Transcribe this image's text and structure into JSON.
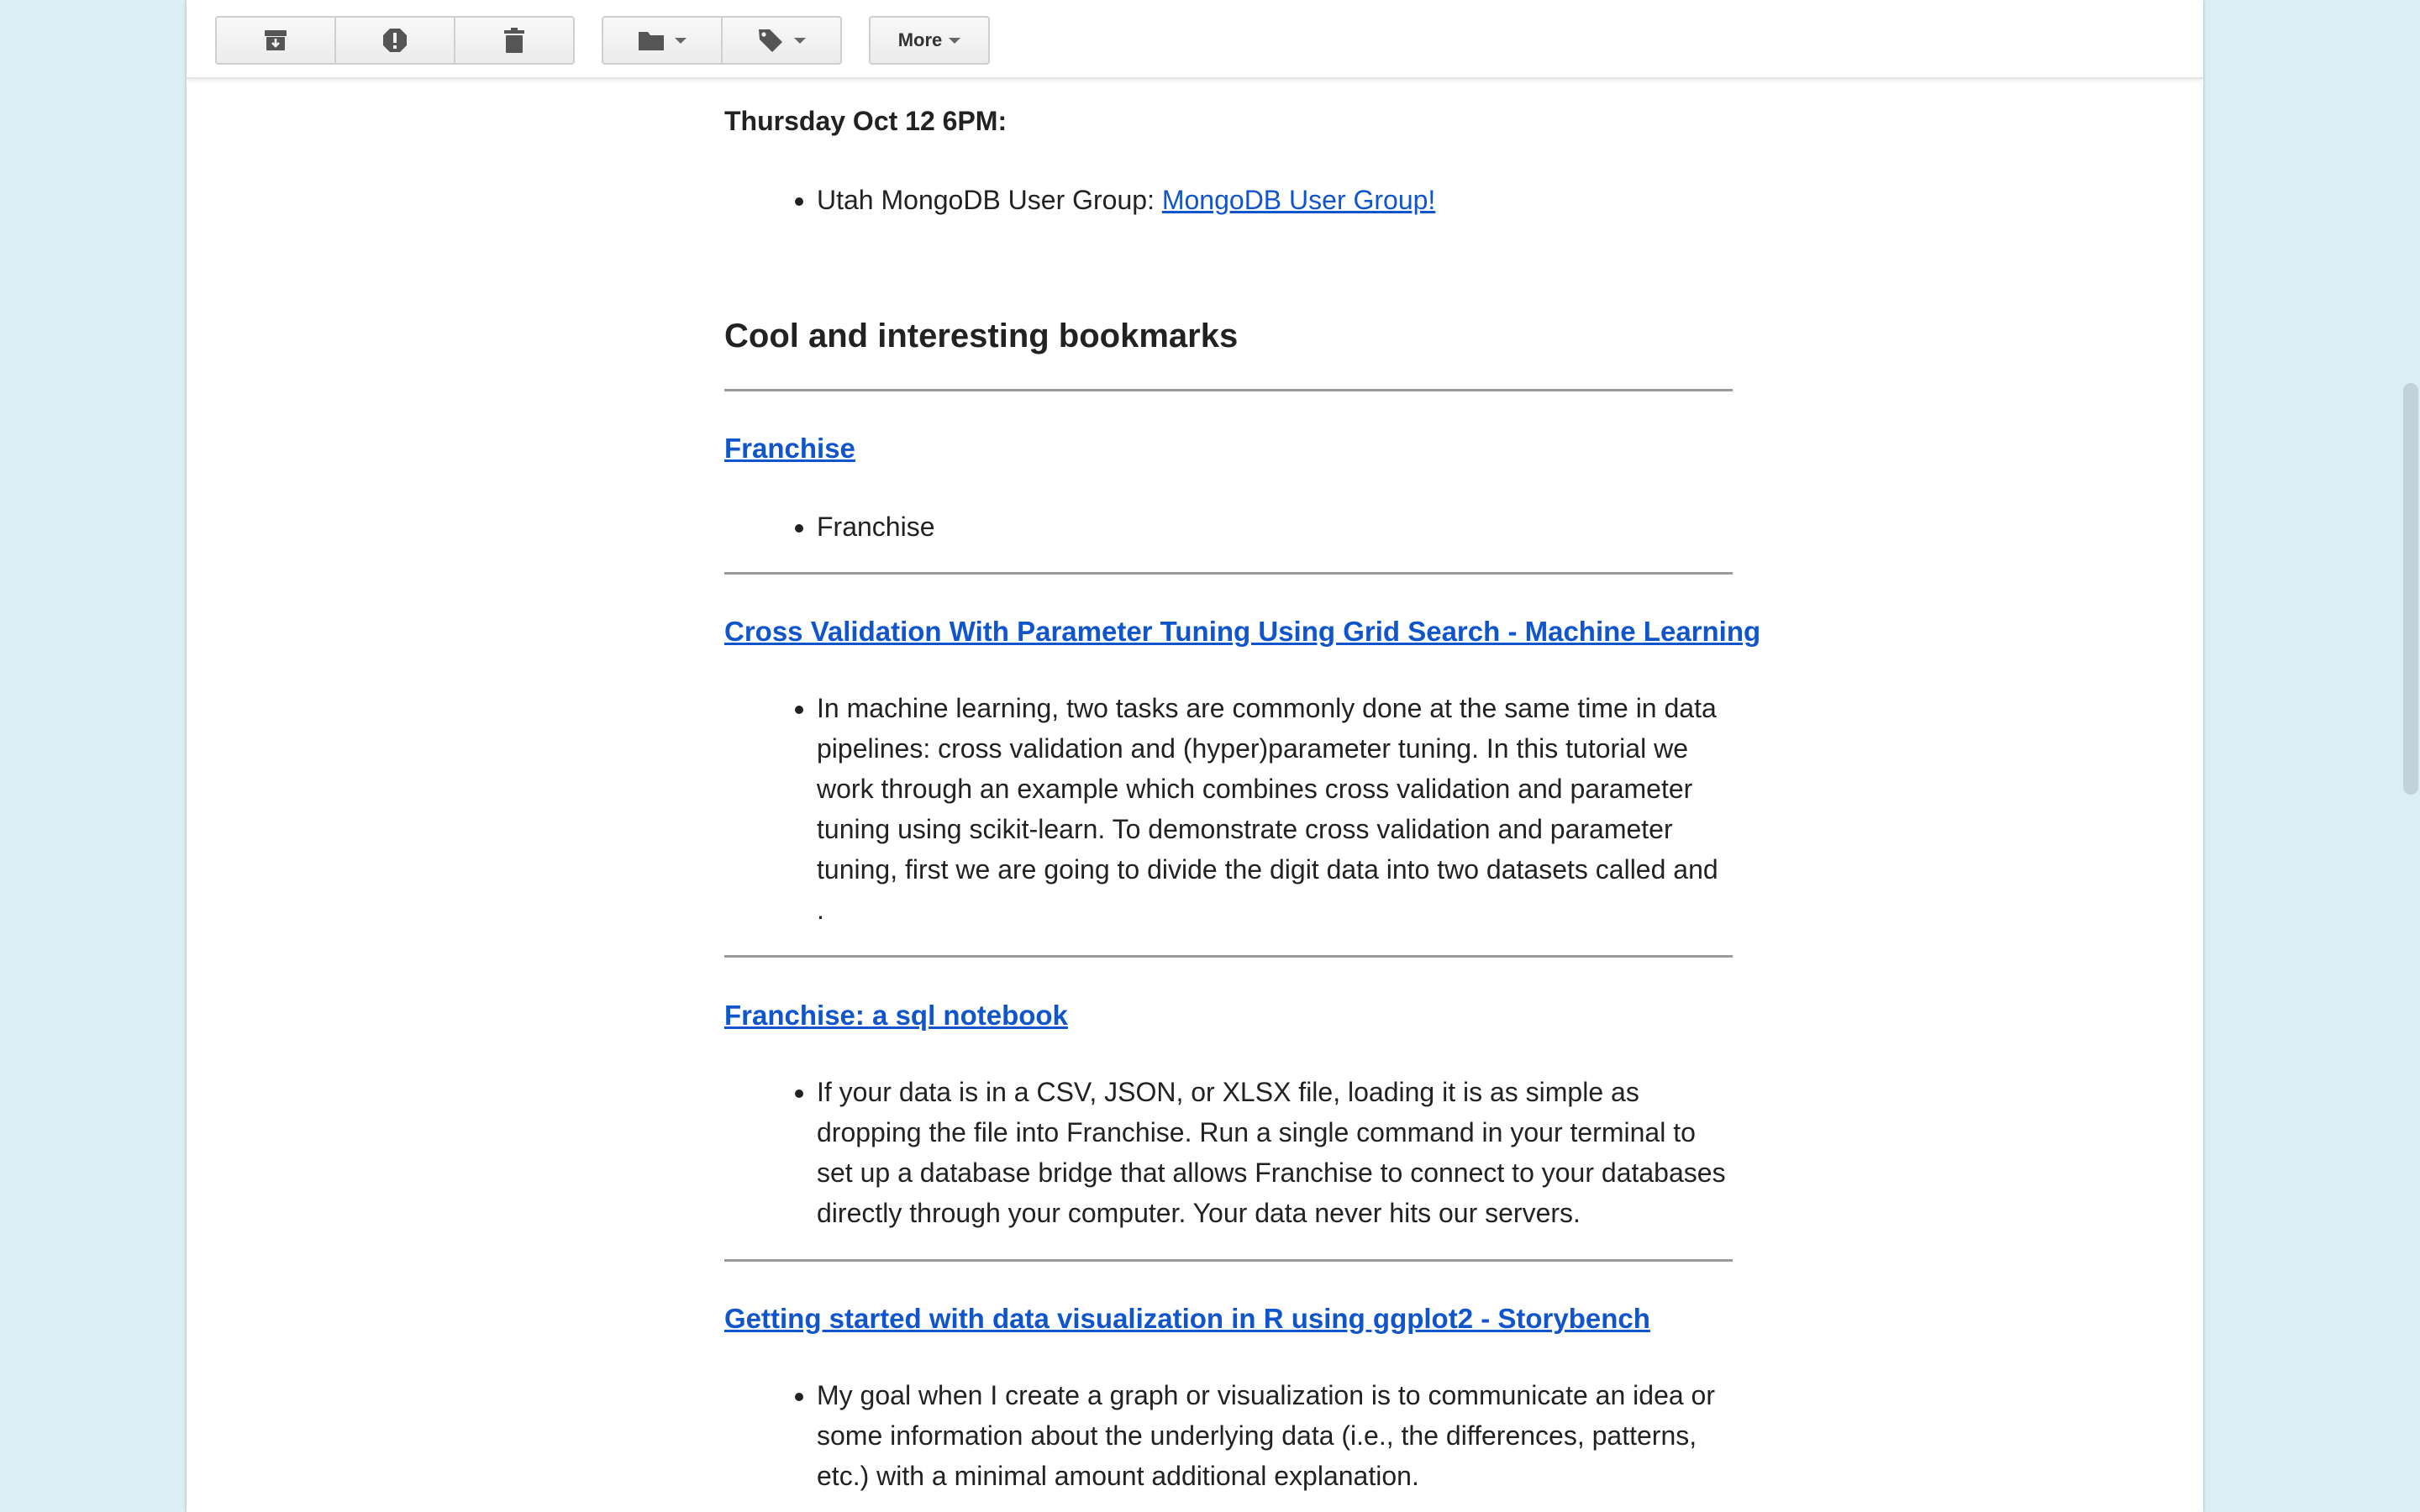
{
  "toolbar": {
    "archive_icon": "archive-icon",
    "spam_icon": "report-spam-icon",
    "delete_icon": "trash-icon",
    "move_icon": "folder-icon",
    "label_icon": "tag-icon",
    "more_label": "More"
  },
  "email": {
    "event_heading": "Thursday Oct 12 6PM:",
    "event_item_text": "Utah MongoDB User Group: ",
    "event_item_link": "MongoDB User Group!",
    "section_heading": "Cool and interesting bookmarks",
    "bookmarks": [
      {
        "title": "Franchise",
        "description": "Franchise"
      },
      {
        "title": "Cross Validation With Parameter Tuning Using Grid Search - Machine Learning",
        "description": "In machine learning, two tasks are commonly done at the same time in data pipelines: cross validation and (hyper)parameter tuning. In this tutorial we work through an example which combines cross validation and parameter tuning using scikit-learn. To demonstrate cross validation and parameter tuning, first we are going to divide the digit data into two datasets called and ."
      },
      {
        "title": "Franchise: a sql notebook",
        "description": "If your data is in a CSV, JSON, or XLSX file, loading it is as simple as dropping the file into Franchise. Run a single command in your terminal to set up a database bridge that allows Franchise to connect to your databases directly through your computer. Your data never hits our servers."
      },
      {
        "title": "Getting started with data visualization in R using ggplot2 - Storybench",
        "description": "My goal when I create a graph or visualization is to communicate an idea or some information about the underlying data (i.e., the differences, patterns, etc.) with a minimal amount additional explanation."
      }
    ]
  },
  "colors": {
    "background": "#dbeef5",
    "link": "#1155cc",
    "text": "#222222"
  }
}
